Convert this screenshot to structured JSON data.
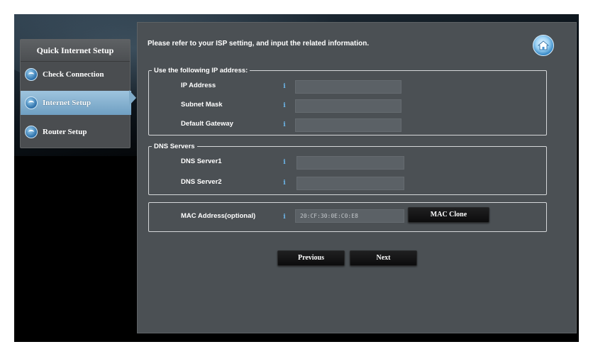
{
  "sidebar": {
    "title": "Quick Internet Setup",
    "items": [
      {
        "label": "Check Connection"
      },
      {
        "label": "Internet Setup"
      },
      {
        "label": "Router Setup"
      }
    ]
  },
  "main": {
    "instruction": "Please refer to your ISP setting, and input the related information.",
    "ip_section": {
      "legend": "Use the following IP address:",
      "ip_address_label": "IP Address",
      "ip_address_value": "",
      "subnet_mask_label": "Subnet Mask",
      "subnet_mask_value": "",
      "default_gateway_label": "Default Gateway",
      "default_gateway_value": ""
    },
    "dns_section": {
      "legend": "DNS Servers",
      "dns1_label": "DNS Server1",
      "dns1_value": "",
      "dns2_label": "DNS Server2",
      "dns2_value": ""
    },
    "mac_section": {
      "label": "MAC Address(optional)",
      "value": "20:CF:30:0E:C0:E8",
      "clone_button": "MAC Clone"
    },
    "buttons": {
      "previous": "Previous",
      "next": "Next"
    }
  },
  "icons": {
    "info": "i",
    "home": "home-icon",
    "bullet": "globe-icon"
  },
  "colors": {
    "accent": "#7fabc9",
    "panel_bg": "#4b5054",
    "info_icon": "#6cb5e8"
  }
}
